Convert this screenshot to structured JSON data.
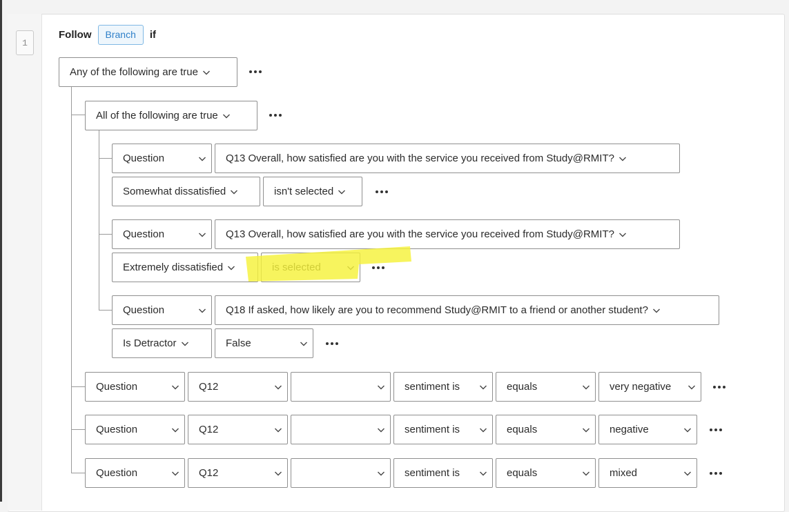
{
  "step": {
    "number": "1"
  },
  "header": {
    "follow": "Follow",
    "branch": "Branch",
    "if": "if"
  },
  "root": {
    "condition": "Any of the following are true"
  },
  "group": {
    "condition": "All of the following are true"
  },
  "group_conditions": [
    {
      "type": "Question",
      "question": "Q13 Overall, how satisfied are you with the service you received from Study@RMIT?",
      "choice": "Somewhat dissatisfied",
      "operator": "isn't selected"
    },
    {
      "type": "Question",
      "question": "Q13 Overall, how satisfied are you with the service you received from Study@RMIT?",
      "choice": "Extremely dissatisfied",
      "operator": "is selected",
      "highlighted": true
    },
    {
      "type": "Question",
      "question": "Q18 If asked, how likely are you to recommend Study@RMIT to a friend or another student?",
      "choice": "Is Detractor",
      "operator": "False"
    }
  ],
  "root_conditions": [
    {
      "type": "Question",
      "question": "Q12",
      "subfield": "",
      "metric": "sentiment is",
      "operator": "equals",
      "value": "very negative"
    },
    {
      "type": "Question",
      "question": "Q12",
      "subfield": "",
      "metric": "sentiment is",
      "operator": "equals",
      "value": "negative"
    },
    {
      "type": "Question",
      "question": "Q12",
      "subfield": "",
      "metric": "sentiment is",
      "operator": "equals",
      "value": "mixed"
    }
  ],
  "colors": {
    "highlight": "#f5f23a",
    "branch_accent": "#2f80c9"
  },
  "icons": {
    "dropdown": "chevron-down-icon",
    "menu": "more-options-icon"
  }
}
